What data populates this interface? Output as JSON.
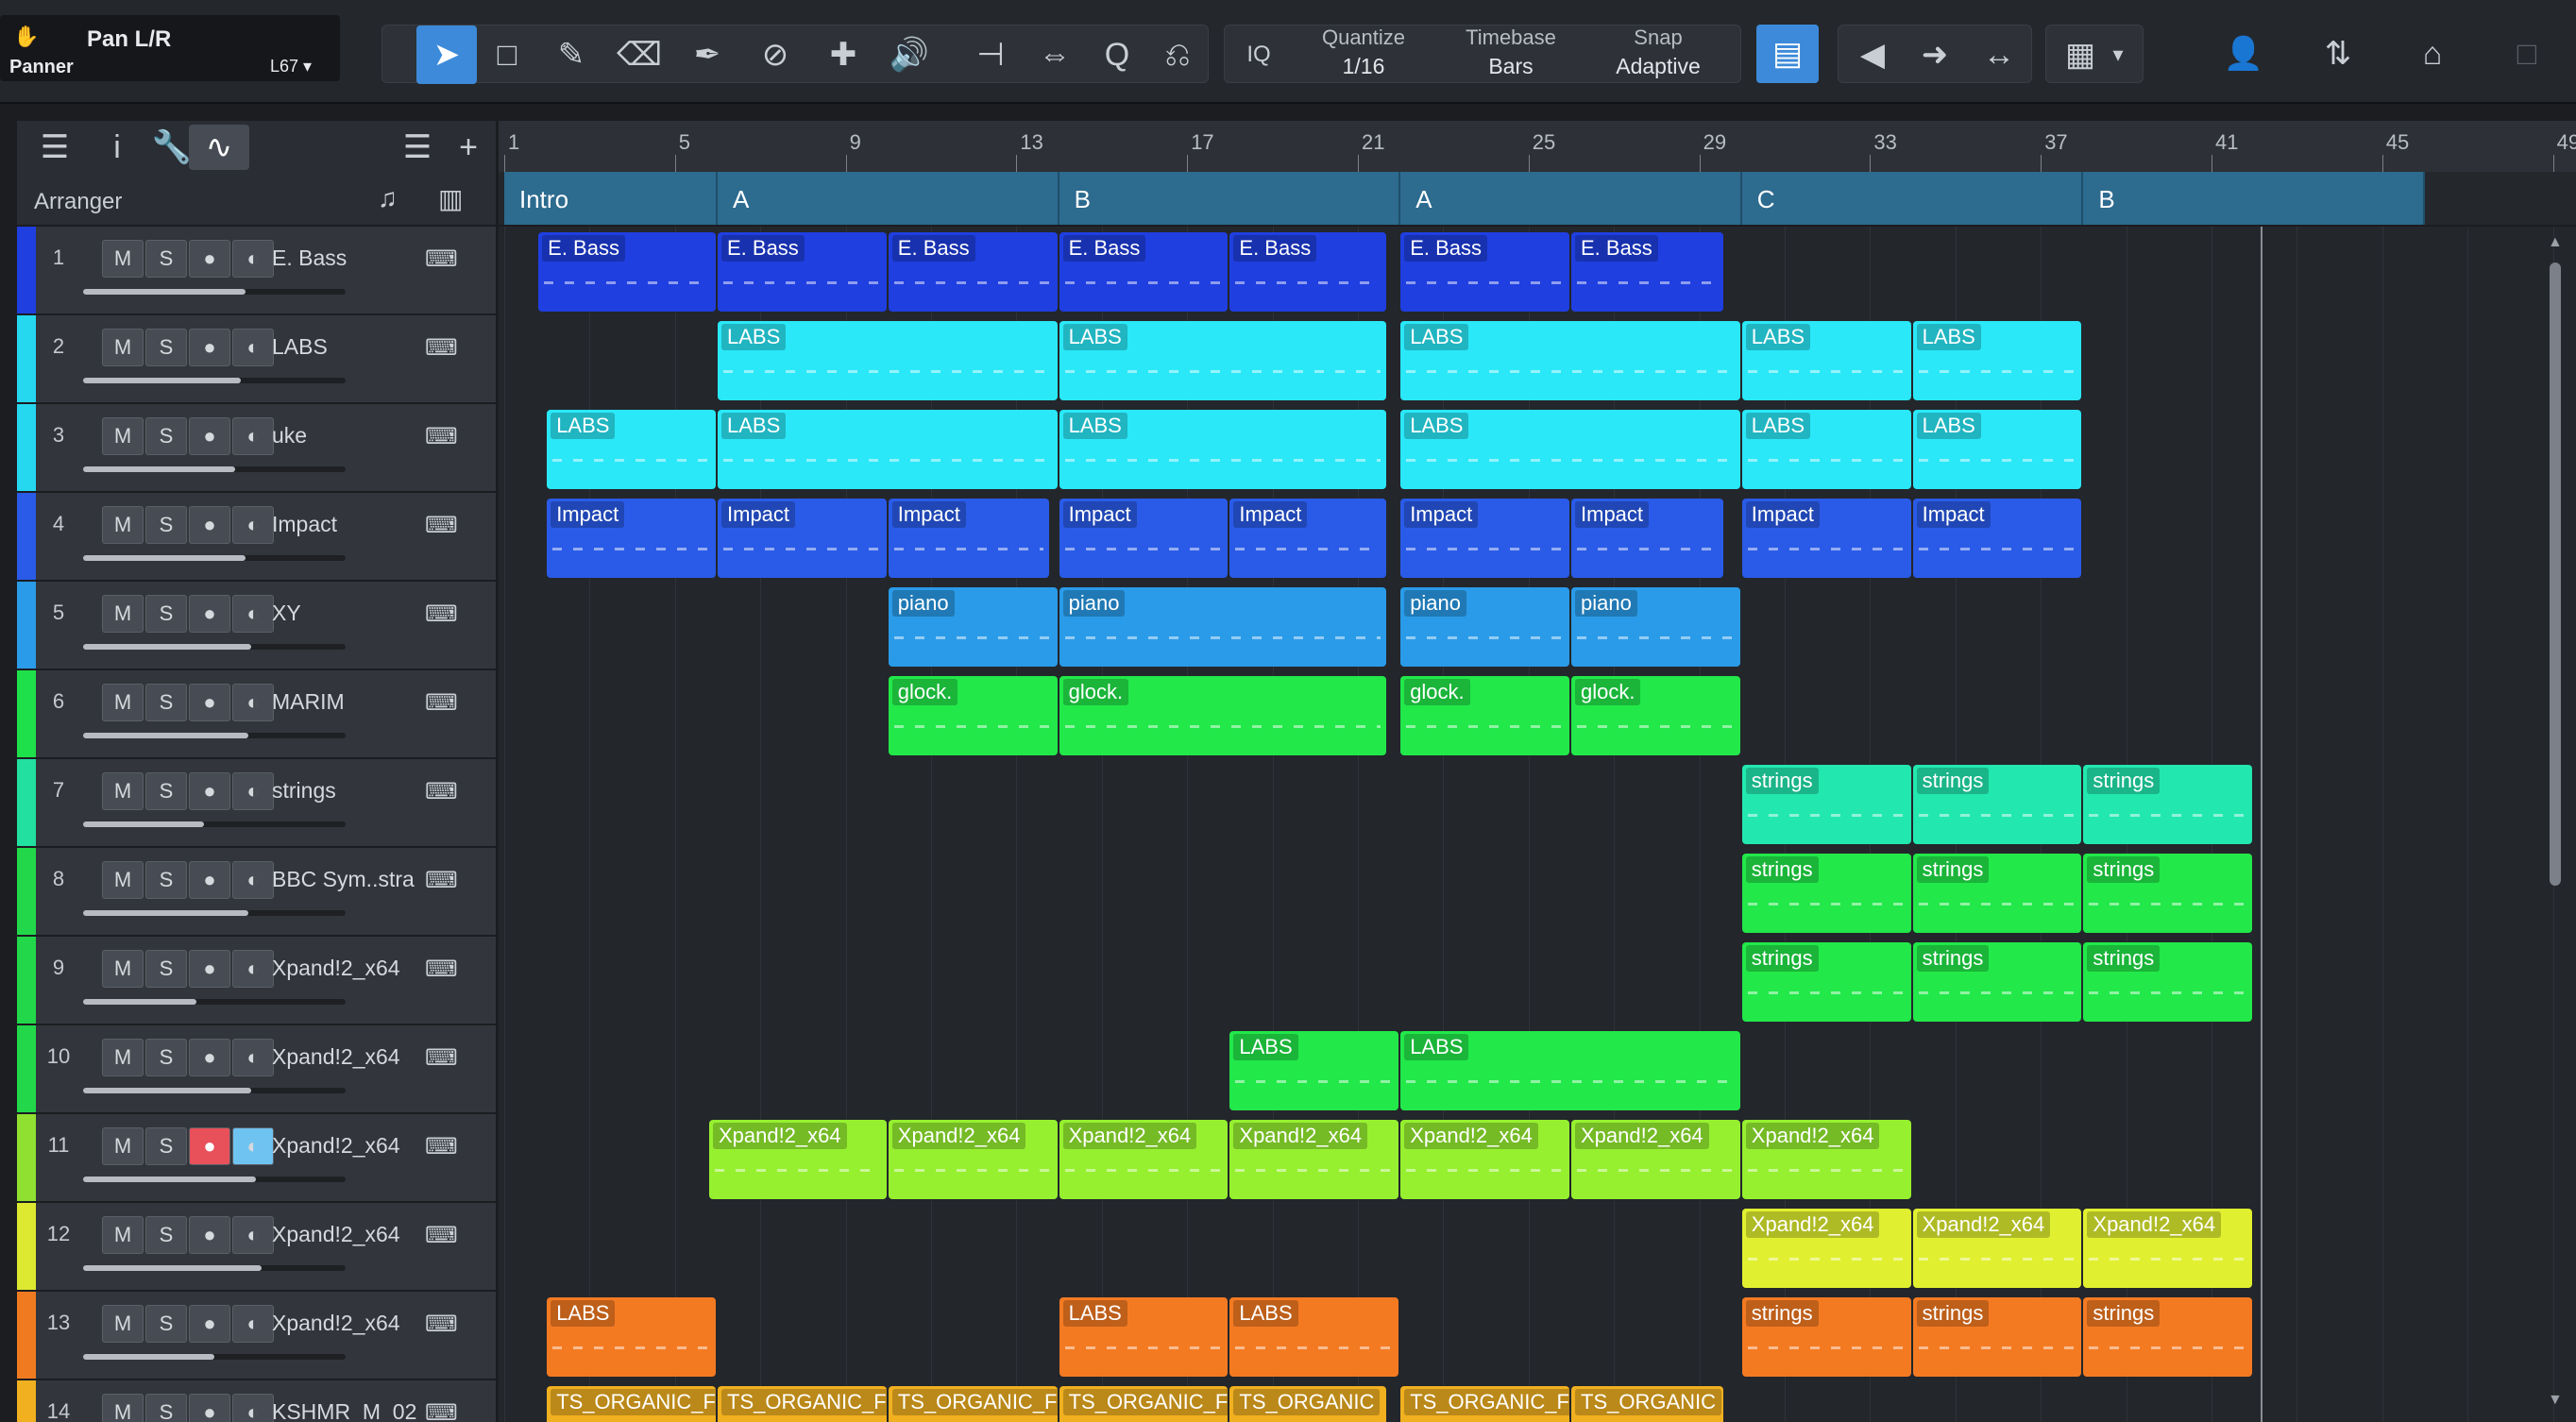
{
  "panner": {
    "title": "Pan L/R",
    "subtitle": "Panner",
    "preset": "L67"
  },
  "toolbar": {
    "quantize_label": "Quantize",
    "quantize_value": "1/16",
    "timebase_label": "Timebase",
    "timebase_value": "Bars",
    "snap_label": "Snap",
    "snap_value": "Adaptive",
    "iq_label": "IQ"
  },
  "tracks_header": {
    "arranger_label": "Arranger"
  },
  "ruler": {
    "bars": [
      "1",
      "5",
      "9",
      "13",
      "17",
      "21",
      "25",
      "29",
      "33",
      "37",
      "41",
      "45",
      "49"
    ]
  },
  "sections": [
    {
      "label": "Intro",
      "start": 1,
      "end": 6
    },
    {
      "label": "A",
      "start": 6,
      "end": 14
    },
    {
      "label": "B",
      "start": 14,
      "end": 22
    },
    {
      "label": "A",
      "start": 22,
      "end": 30
    },
    {
      "label": "C",
      "start": 30,
      "end": 38
    },
    {
      "label": "B",
      "start": 38,
      "end": 46
    }
  ],
  "tracks": [
    {
      "num": "1",
      "name": "E. Bass",
      "color": "#1f3fe0",
      "vol": 0.62
    },
    {
      "num": "2",
      "name": "LABS",
      "color": "#25d8f0",
      "vol": 0.6
    },
    {
      "num": "3",
      "name": "uke",
      "color": "#25d8f0",
      "vol": 0.58
    },
    {
      "num": "4",
      "name": "Impact",
      "color": "#2a5be8",
      "vol": 0.62
    },
    {
      "num": "5",
      "name": "XY",
      "color": "#2a9be8",
      "vol": 0.64
    },
    {
      "num": "6",
      "name": "MARIM",
      "color": "#1ee04a",
      "vol": 0.63
    },
    {
      "num": "7",
      "name": "strings",
      "color": "#22e0a0",
      "vol": 0.46
    },
    {
      "num": "8",
      "name": "BBC Sym..stra",
      "color": "#22d84a",
      "vol": 0.63
    },
    {
      "num": "9",
      "name": "Xpand!2_x64",
      "color": "#22d84a",
      "vol": 0.43
    },
    {
      "num": "10",
      "name": "Xpand!2_x64",
      "color": "#22d84a",
      "vol": 0.64
    },
    {
      "num": "11",
      "name": "Xpand!2_x64",
      "color": "#8fe030",
      "vol": 0.66,
      "rec": true
    },
    {
      "num": "12",
      "name": "Xpand!2_x64",
      "color": "#dde830",
      "vol": 0.68
    },
    {
      "num": "13",
      "name": "Xpand!2_x64",
      "color": "#f07a20",
      "vol": 0.5
    },
    {
      "num": "14",
      "name": "KSHMR_M_02",
      "color": "#f0b020",
      "vol": 0.5
    }
  ],
  "button_labels": {
    "mute": "M",
    "solo": "S"
  },
  "clips": [
    {
      "t": 0,
      "s": 1.8,
      "e": 6,
      "label": "E. Bass",
      "color": "#1f3fe0"
    },
    {
      "t": 0,
      "s": 6,
      "e": 10,
      "label": "E. Bass",
      "color": "#1f3fe0"
    },
    {
      "t": 0,
      "s": 10,
      "e": 14,
      "label": "E. Bass",
      "color": "#1f3fe0"
    },
    {
      "t": 0,
      "s": 14,
      "e": 18,
      "label": "E. Bass",
      "color": "#1f3fe0"
    },
    {
      "t": 0,
      "s": 18,
      "e": 21.7,
      "label": "E. Bass",
      "color": "#1f3fe0"
    },
    {
      "t": 0,
      "s": 22,
      "e": 26,
      "label": "E. Bass",
      "color": "#1f3fe0"
    },
    {
      "t": 0,
      "s": 26,
      "e": 29.6,
      "label": "E. Bass",
      "color": "#1f3fe0"
    },
    {
      "t": 1,
      "s": 6,
      "e": 14,
      "label": "LABS",
      "color": "#2ae8f8"
    },
    {
      "t": 1,
      "s": 14,
      "e": 21.7,
      "label": "LABS",
      "color": "#2ae8f8"
    },
    {
      "t": 1,
      "s": 22,
      "e": 30,
      "label": "LABS",
      "color": "#2ae8f8"
    },
    {
      "t": 1,
      "s": 30,
      "e": 34,
      "label": "LABS",
      "color": "#2ae8f8"
    },
    {
      "t": 1,
      "s": 34,
      "e": 38,
      "label": "LABS",
      "color": "#2ae8f8"
    },
    {
      "t": 2,
      "s": 2,
      "e": 6,
      "label": "LABS",
      "color": "#2ae8f8"
    },
    {
      "t": 2,
      "s": 6,
      "e": 14,
      "label": "LABS",
      "color": "#2ae8f8"
    },
    {
      "t": 2,
      "s": 14,
      "e": 21.7,
      "label": "LABS",
      "color": "#2ae8f8"
    },
    {
      "t": 2,
      "s": 22,
      "e": 30,
      "label": "LABS",
      "color": "#2ae8f8"
    },
    {
      "t": 2,
      "s": 30,
      "e": 34,
      "label": "LABS",
      "color": "#2ae8f8"
    },
    {
      "t": 2,
      "s": 34,
      "e": 38,
      "label": "LABS",
      "color": "#2ae8f8"
    },
    {
      "t": 3,
      "s": 2,
      "e": 6,
      "label": "Impact",
      "color": "#2a5be8"
    },
    {
      "t": 3,
      "s": 6,
      "e": 10,
      "label": "Impact",
      "color": "#2a5be8"
    },
    {
      "t": 3,
      "s": 10,
      "e": 13.8,
      "label": "Impact",
      "color": "#2a5be8"
    },
    {
      "t": 3,
      "s": 14,
      "e": 18,
      "label": "Impact",
      "color": "#2a5be8"
    },
    {
      "t": 3,
      "s": 18,
      "e": 21.7,
      "label": "Impact",
      "color": "#2a5be8"
    },
    {
      "t": 3,
      "s": 22,
      "e": 26,
      "label": "Impact",
      "color": "#2a5be8"
    },
    {
      "t": 3,
      "s": 26,
      "e": 29.6,
      "label": "Impact",
      "color": "#2a5be8"
    },
    {
      "t": 3,
      "s": 30,
      "e": 34,
      "label": "Impact",
      "color": "#2a5be8"
    },
    {
      "t": 3,
      "s": 34,
      "e": 38,
      "label": "Impact",
      "color": "#2a5be8"
    },
    {
      "t": 4,
      "s": 10,
      "e": 14,
      "label": "piano",
      "color": "#2a9be8"
    },
    {
      "t": 4,
      "s": 14,
      "e": 21.7,
      "label": "piano",
      "color": "#2a9be8"
    },
    {
      "t": 4,
      "s": 22,
      "e": 26,
      "label": "piano",
      "color": "#2a9be8"
    },
    {
      "t": 4,
      "s": 26,
      "e": 30,
      "label": "piano",
      "color": "#2a9be8"
    },
    {
      "t": 5,
      "s": 10,
      "e": 14,
      "label": "glock.",
      "color": "#22e84a"
    },
    {
      "t": 5,
      "s": 14,
      "e": 21.7,
      "label": "glock.",
      "color": "#22e84a"
    },
    {
      "t": 5,
      "s": 22,
      "e": 26,
      "label": "glock.",
      "color": "#22e84a"
    },
    {
      "t": 5,
      "s": 26,
      "e": 30,
      "label": "glock.",
      "color": "#22e84a"
    },
    {
      "t": 6,
      "s": 30,
      "e": 34,
      "label": "strings",
      "color": "#22e8b0"
    },
    {
      "t": 6,
      "s": 34,
      "e": 38,
      "label": "strings",
      "color": "#22e8b0"
    },
    {
      "t": 6,
      "s": 38,
      "e": 42,
      "label": "strings",
      "color": "#22e8b0"
    },
    {
      "t": 7,
      "s": 30,
      "e": 34,
      "label": "strings",
      "color": "#22e84a"
    },
    {
      "t": 7,
      "s": 34,
      "e": 38,
      "label": "strings",
      "color": "#22e84a"
    },
    {
      "t": 7,
      "s": 38,
      "e": 42,
      "label": "strings",
      "color": "#22e84a"
    },
    {
      "t": 8,
      "s": 30,
      "e": 34,
      "label": "strings",
      "color": "#22e84a"
    },
    {
      "t": 8,
      "s": 34,
      "e": 38,
      "label": "strings",
      "color": "#22e84a"
    },
    {
      "t": 8,
      "s": 38,
      "e": 42,
      "label": "strings",
      "color": "#22e84a"
    },
    {
      "t": 9,
      "s": 18,
      "e": 22,
      "label": "LABS",
      "color": "#22e84a"
    },
    {
      "t": 9,
      "s": 22,
      "e": 30,
      "label": "LABS",
      "color": "#22e84a"
    },
    {
      "t": 10,
      "s": 5.8,
      "e": 10,
      "label": "Xpand!2_x64",
      "color": "#96f030"
    },
    {
      "t": 10,
      "s": 10,
      "e": 14,
      "label": "Xpand!2_x64",
      "color": "#96f030"
    },
    {
      "t": 10,
      "s": 14,
      "e": 18,
      "label": "Xpand!2_x64",
      "color": "#96f030"
    },
    {
      "t": 10,
      "s": 18,
      "e": 22,
      "label": "Xpand!2_x64",
      "color": "#96f030"
    },
    {
      "t": 10,
      "s": 22,
      "e": 26,
      "label": "Xpand!2_x64",
      "color": "#96f030"
    },
    {
      "t": 10,
      "s": 26,
      "e": 30,
      "label": "Xpand!2_x64",
      "color": "#96f030"
    },
    {
      "t": 10,
      "s": 30,
      "e": 34,
      "label": "Xpand!2_x64",
      "color": "#96f030"
    },
    {
      "t": 11,
      "s": 30,
      "e": 34,
      "label": "Xpand!2_x64",
      "color": "#e0f030"
    },
    {
      "t": 11,
      "s": 34,
      "e": 38,
      "label": "Xpand!2_x64",
      "color": "#e0f030"
    },
    {
      "t": 11,
      "s": 38,
      "e": 42,
      "label": "Xpand!2_x64",
      "color": "#e0f030"
    },
    {
      "t": 12,
      "s": 2,
      "e": 6,
      "label": "LABS",
      "color": "#f47a22"
    },
    {
      "t": 12,
      "s": 14,
      "e": 18,
      "label": "LABS",
      "color": "#f47a22"
    },
    {
      "t": 12,
      "s": 18,
      "e": 22,
      "label": "LABS",
      "color": "#f47a22"
    },
    {
      "t": 12,
      "s": 30,
      "e": 34,
      "label": "strings",
      "color": "#f47a22"
    },
    {
      "t": 12,
      "s": 34,
      "e": 38,
      "label": "strings",
      "color": "#f47a22"
    },
    {
      "t": 12,
      "s": 38,
      "e": 42,
      "label": "strings",
      "color": "#f47a22"
    },
    {
      "t": 13,
      "s": 2,
      "e": 6,
      "label": "TS_ORGANIC_F",
      "color": "#f0b020"
    },
    {
      "t": 13,
      "s": 6,
      "e": 10,
      "label": "TS_ORGANIC_F",
      "color": "#f0b020"
    },
    {
      "t": 13,
      "s": 10,
      "e": 14,
      "label": "TS_ORGANIC_F",
      "color": "#f0b020"
    },
    {
      "t": 13,
      "s": 14,
      "e": 18,
      "label": "TS_ORGANIC_F",
      "color": "#f0b020"
    },
    {
      "t": 13,
      "s": 18,
      "e": 21.7,
      "label": "TS_ORGANIC",
      "color": "#f0b020"
    },
    {
      "t": 13,
      "s": 22,
      "e": 26,
      "label": "TS_ORGANIC_F",
      "color": "#f0b020"
    },
    {
      "t": 13,
      "s": 26,
      "e": 29.6,
      "label": "TS_ORGANIC",
      "color": "#f0b020"
    }
  ]
}
